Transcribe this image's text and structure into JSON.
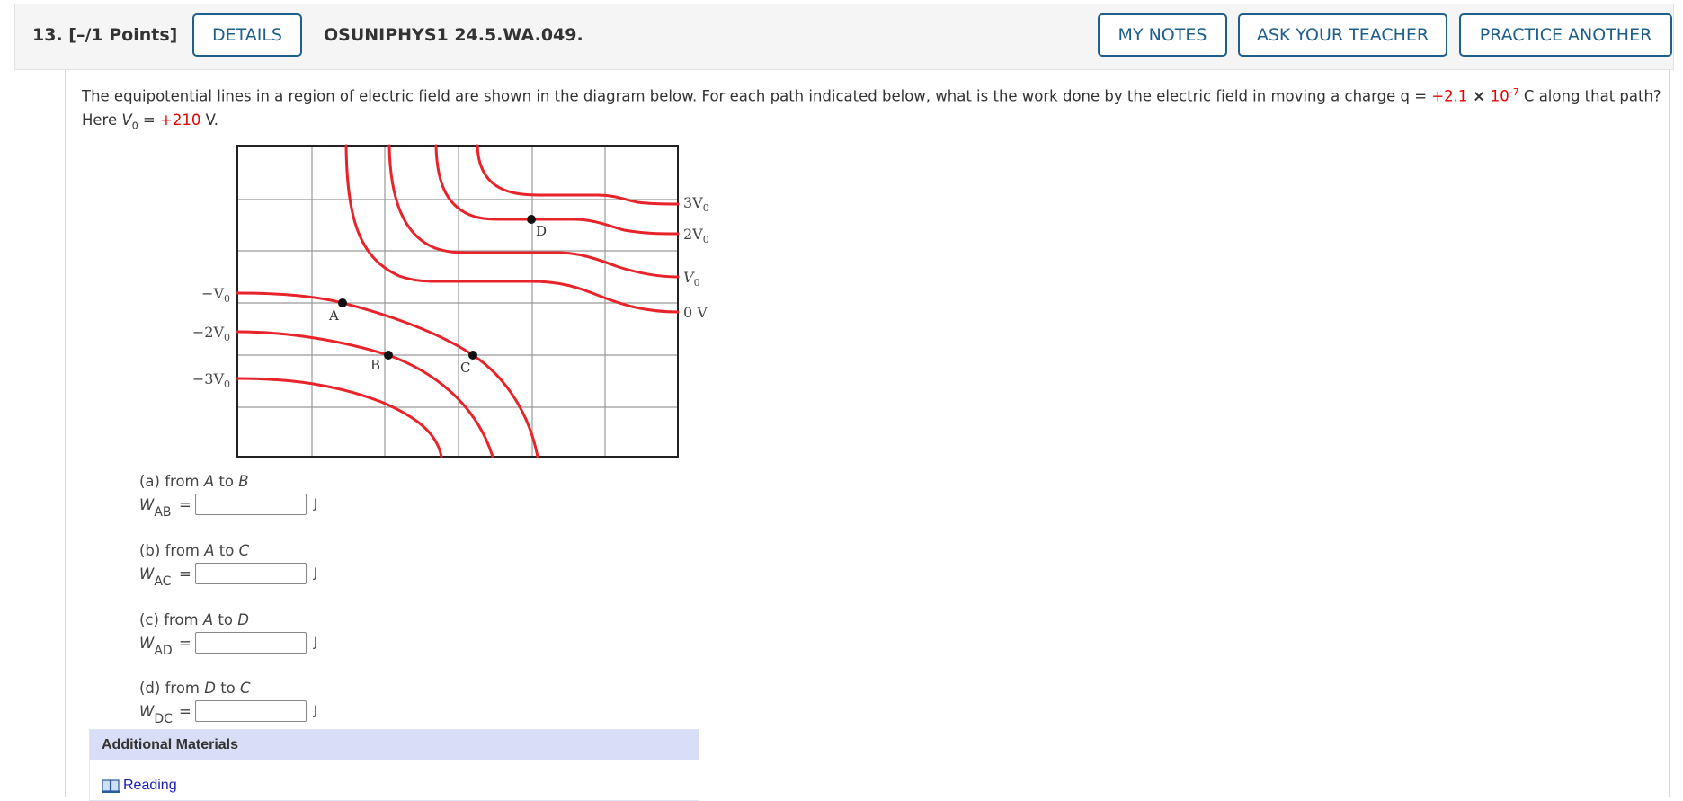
{
  "header": {
    "question_number": "13.",
    "points": "[–/1 Points]",
    "details_label": "DETAILS",
    "question_id": "OSUNIPHYS1 24.5.WA.049.",
    "my_notes_label": "MY NOTES",
    "ask_teacher_label": "ASK YOUR TEACHER",
    "practice_another_label": "PRACTICE ANOTHER"
  },
  "prompt": {
    "text_1": "The equipotential lines in a region of electric field are shown in the diagram below. For each path indicated below, what is the work done by the electric field in moving a charge q = ",
    "charge_value": "+2.1",
    "times": " × ",
    "charge_base": "10",
    "charge_exp": "-7",
    "text_2": " C along that path?",
    "here": "Here ",
    "v_symbol": "V",
    "v_sub": "0",
    "eq": " = ",
    "v0_value": "+210",
    "v_unit": " V."
  },
  "diagram": {
    "right_labels": [
      {
        "sym": "3V",
        "sub": "0"
      },
      {
        "sym": "2V",
        "sub": "0"
      },
      {
        "sym": "V",
        "sub": "0"
      },
      {
        "sym": "0 V",
        "sub": ""
      }
    ],
    "left_labels": [
      {
        "sym": "−V",
        "sub": "0"
      },
      {
        "sym": "−2V",
        "sub": "0"
      },
      {
        "sym": "−3V",
        "sub": "0"
      }
    ],
    "points": [
      "A",
      "B",
      "C",
      "D"
    ],
    "line_color": "#e8232a"
  },
  "parts": [
    {
      "question": "(a) from ",
      "from": "A",
      "to_word": " to ",
      "to": "B",
      "w": "W",
      "sub": "AB",
      "value": "",
      "unit": "J"
    },
    {
      "question": "(b) from ",
      "from": "A",
      "to_word": " to ",
      "to": "C",
      "w": "W",
      "sub": "AC",
      "value": "",
      "unit": "J"
    },
    {
      "question": "(c) from ",
      "from": "A",
      "to_word": " to ",
      "to": "D",
      "w": "W",
      "sub": "AD",
      "value": "",
      "unit": "J"
    },
    {
      "question": "(d) from ",
      "from": "D",
      "to_word": " to ",
      "to": "C",
      "w": "W",
      "sub": "DC",
      "value": "",
      "unit": "J"
    }
  ],
  "additional": {
    "title": "Additional Materials",
    "reading_label": "Reading"
  }
}
